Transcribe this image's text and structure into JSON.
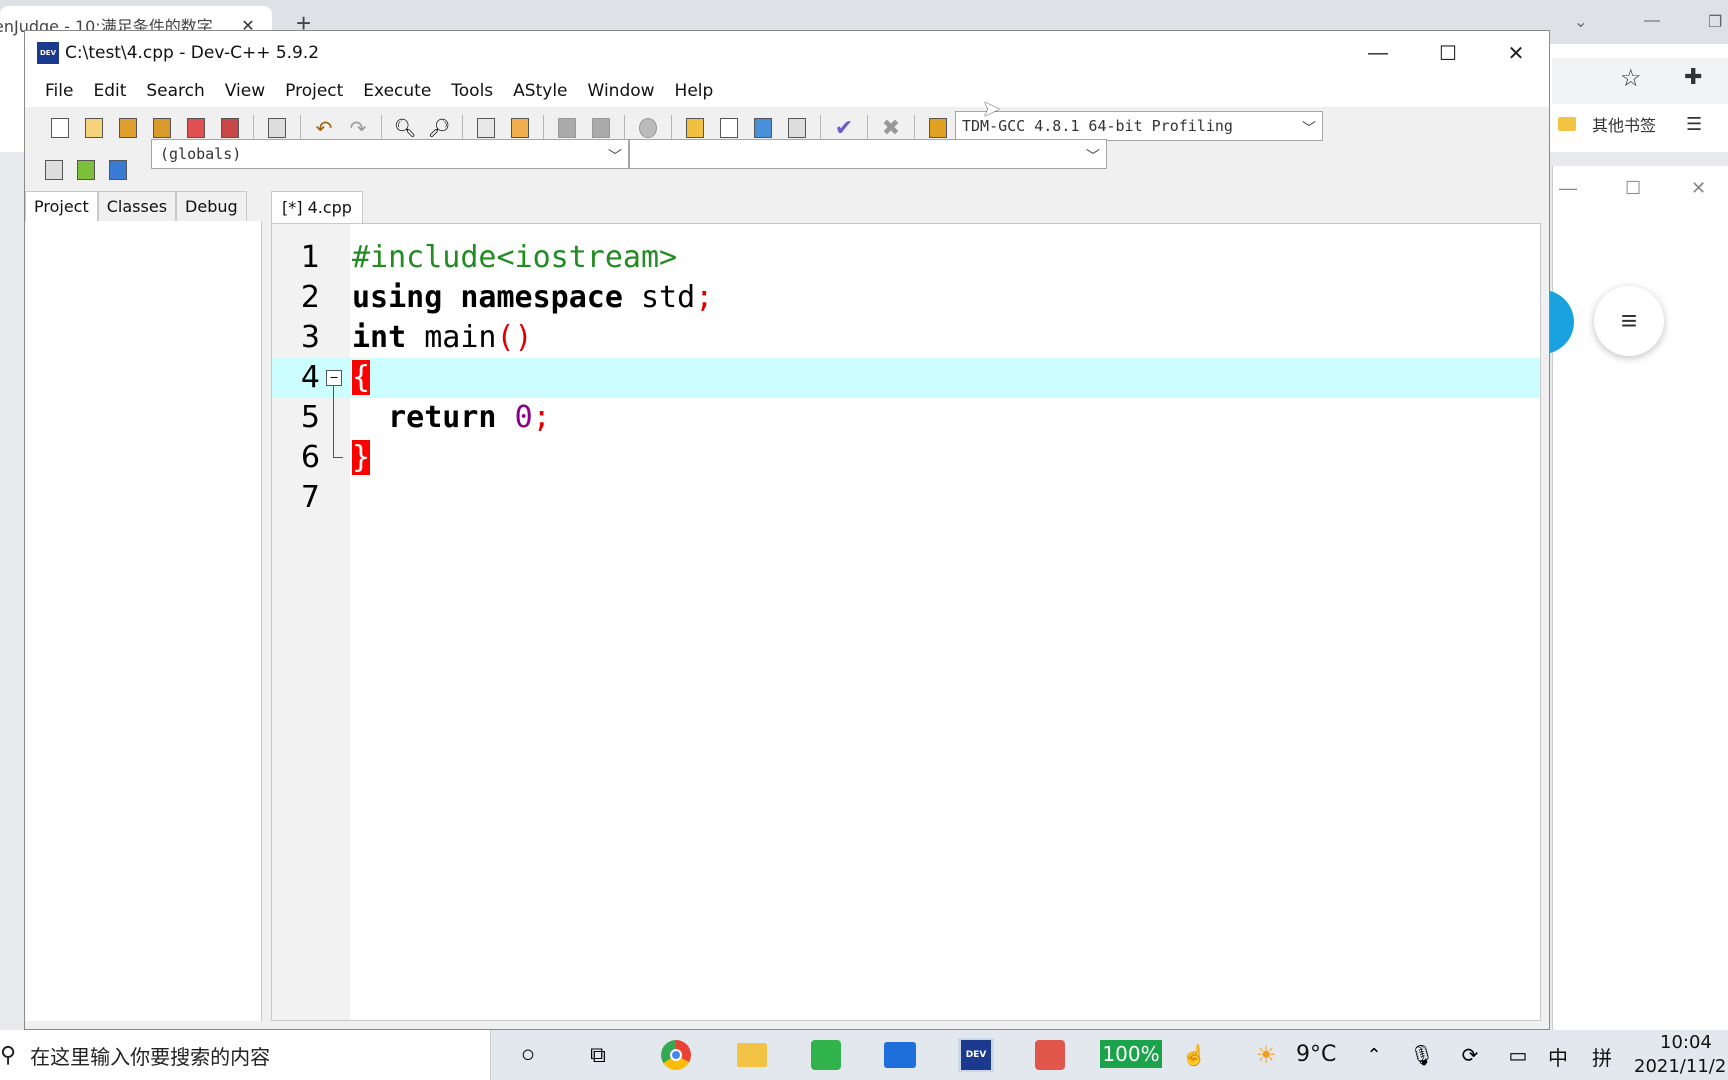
{
  "browser": {
    "tab_title": "enJudge - 10:满足条件的数字",
    "tab_close": "✕",
    "new_tab": "+",
    "bookmarks_label": "其他书签"
  },
  "window": {
    "title": "C:\\test\\4.cpp - Dev-C++ 5.9.2",
    "icon_text": "DEV"
  },
  "menu": [
    "File",
    "Edit",
    "Search",
    "View",
    "Project",
    "Execute",
    "Tools",
    "AStyle",
    "Window",
    "Help"
  ],
  "toolbar": {
    "compiler": "TDM-GCC 4.8.1 64-bit Profiling",
    "scope": "(globals)",
    "member": ""
  },
  "left_tabs": [
    "Project",
    "Classes",
    "Debug"
  ],
  "editor": {
    "tab_label": "[*] 4.cpp",
    "current_line": 4,
    "line_numbers": [
      "1",
      "2",
      "3",
      "4",
      "5",
      "6",
      "7"
    ]
  },
  "taskbar": {
    "search_placeholder": "在这里输入你要搜索的内容",
    "battery": "100%",
    "weather": "9°C",
    "ime_lang": "中",
    "ime_mode": "拼",
    "time": "10:04",
    "date": "2021/11/2"
  },
  "colors": {
    "keyword": "#000000",
    "preprocessor": "#228b22",
    "symbol": "#e00000",
    "number": "#8b008b",
    "current_line_bg": "#ccfdff",
    "brace_highlight": "#ff0000"
  }
}
